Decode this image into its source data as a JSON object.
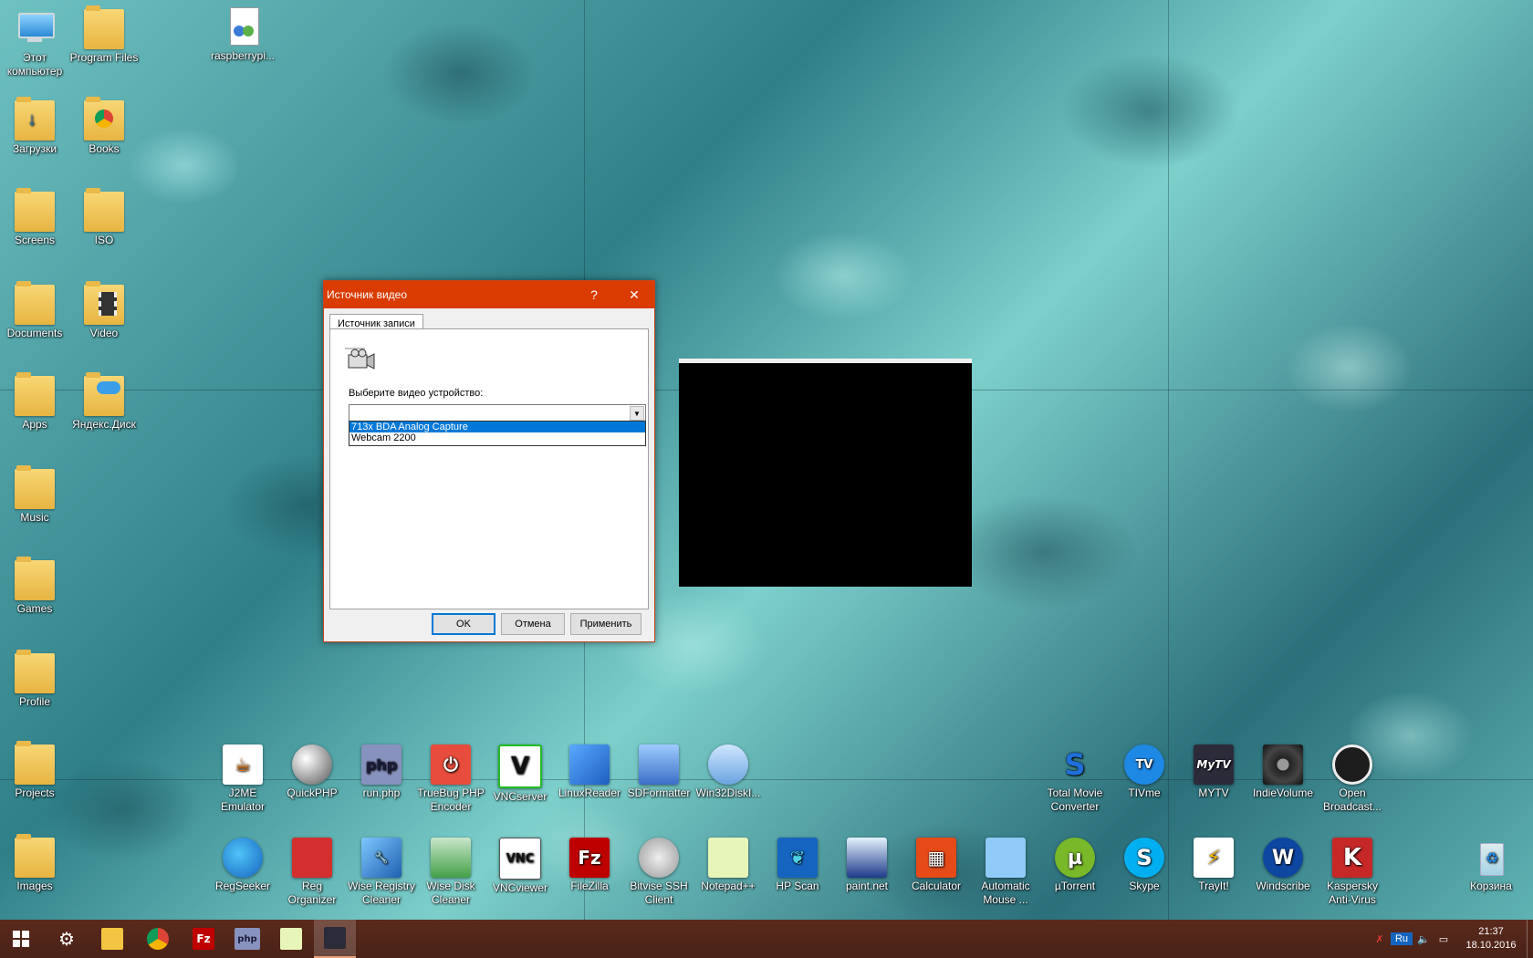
{
  "desktop": {
    "left_icons": [
      {
        "label": "Этот компьютер"
      },
      {
        "label": "Program Files"
      },
      {
        "label": "raspberrypi..."
      },
      {
        "label": "Загрузки"
      },
      {
        "label": "Books"
      },
      {
        "label": "Screens"
      },
      {
        "label": "ISO"
      },
      {
        "label": "Documents"
      },
      {
        "label": "Video"
      },
      {
        "label": "Apps"
      },
      {
        "label": "Яндекс.Диск"
      },
      {
        "label": "Music"
      },
      {
        "label": "Games"
      },
      {
        "label": "Profile"
      },
      {
        "label": "Projects"
      },
      {
        "label": "Images"
      }
    ],
    "row1_icons": [
      {
        "label": "J2ME Emulator"
      },
      {
        "label": "QuickPHP"
      },
      {
        "label": "run.php",
        "glyph": "php"
      },
      {
        "label": "TrueBug PHP Encoder"
      },
      {
        "label": "VNCserver",
        "glyph": "V"
      },
      {
        "label": "LinuxReader"
      },
      {
        "label": "SDFormatter"
      },
      {
        "label": "Win32DiskI..."
      },
      {
        "label": "Total Movie Converter",
        "glyph": "S"
      },
      {
        "label": "TIVme",
        "glyph": "TV"
      },
      {
        "label": "MYTV",
        "glyph": "MyTV"
      },
      {
        "label": "IndieVolume"
      },
      {
        "label": "Open Broadcast..."
      }
    ],
    "row2_icons": [
      {
        "label": "RegSeeker"
      },
      {
        "label": "Reg Organizer"
      },
      {
        "label": "Wise Registry Cleaner"
      },
      {
        "label": "Wise Disk Cleaner"
      },
      {
        "label": "VNCviewer",
        "glyph": "VNC"
      },
      {
        "label": "FileZilla",
        "glyph": "Fz"
      },
      {
        "label": "Bitvise SSH Client"
      },
      {
        "label": "Notepad++"
      },
      {
        "label": "HP Scan"
      },
      {
        "label": "paint.net"
      },
      {
        "label": "Calculator"
      },
      {
        "label": "Automatic Mouse ..."
      },
      {
        "label": "µTorrent",
        "glyph": "µ"
      },
      {
        "label": "Skype",
        "glyph": "S"
      },
      {
        "label": "TrayIt!"
      },
      {
        "label": "Windscribe",
        "glyph": "W"
      },
      {
        "label": "Kaspersky Anti-Virus",
        "glyph": "K"
      },
      {
        "label": "Корзина"
      }
    ]
  },
  "dialog": {
    "title": "Источник видео",
    "help_glyph": "?",
    "close_glyph": "✕",
    "tab_label": "Источник записи",
    "select_label": "Выберите видео устройство:",
    "combo_value": "",
    "options": [
      "713x BDA Analog Capture",
      "Webcam 2200"
    ],
    "selected_option": "713x BDA Analog Capture",
    "ok_label": "OK",
    "cancel_label": "Отмена",
    "apply_label": "Применить"
  },
  "taskbar": {
    "items": [
      {
        "name": "start-button"
      },
      {
        "name": "settings"
      },
      {
        "name": "file-explorer"
      },
      {
        "name": "chrome"
      },
      {
        "name": "filezilla",
        "glyph": "Fz"
      },
      {
        "name": "php",
        "glyph": "php"
      },
      {
        "name": "notepad"
      },
      {
        "name": "mytv-active"
      }
    ],
    "tray": {
      "language": "Ru",
      "time": "21:37",
      "date": "18.10.2016"
    }
  }
}
